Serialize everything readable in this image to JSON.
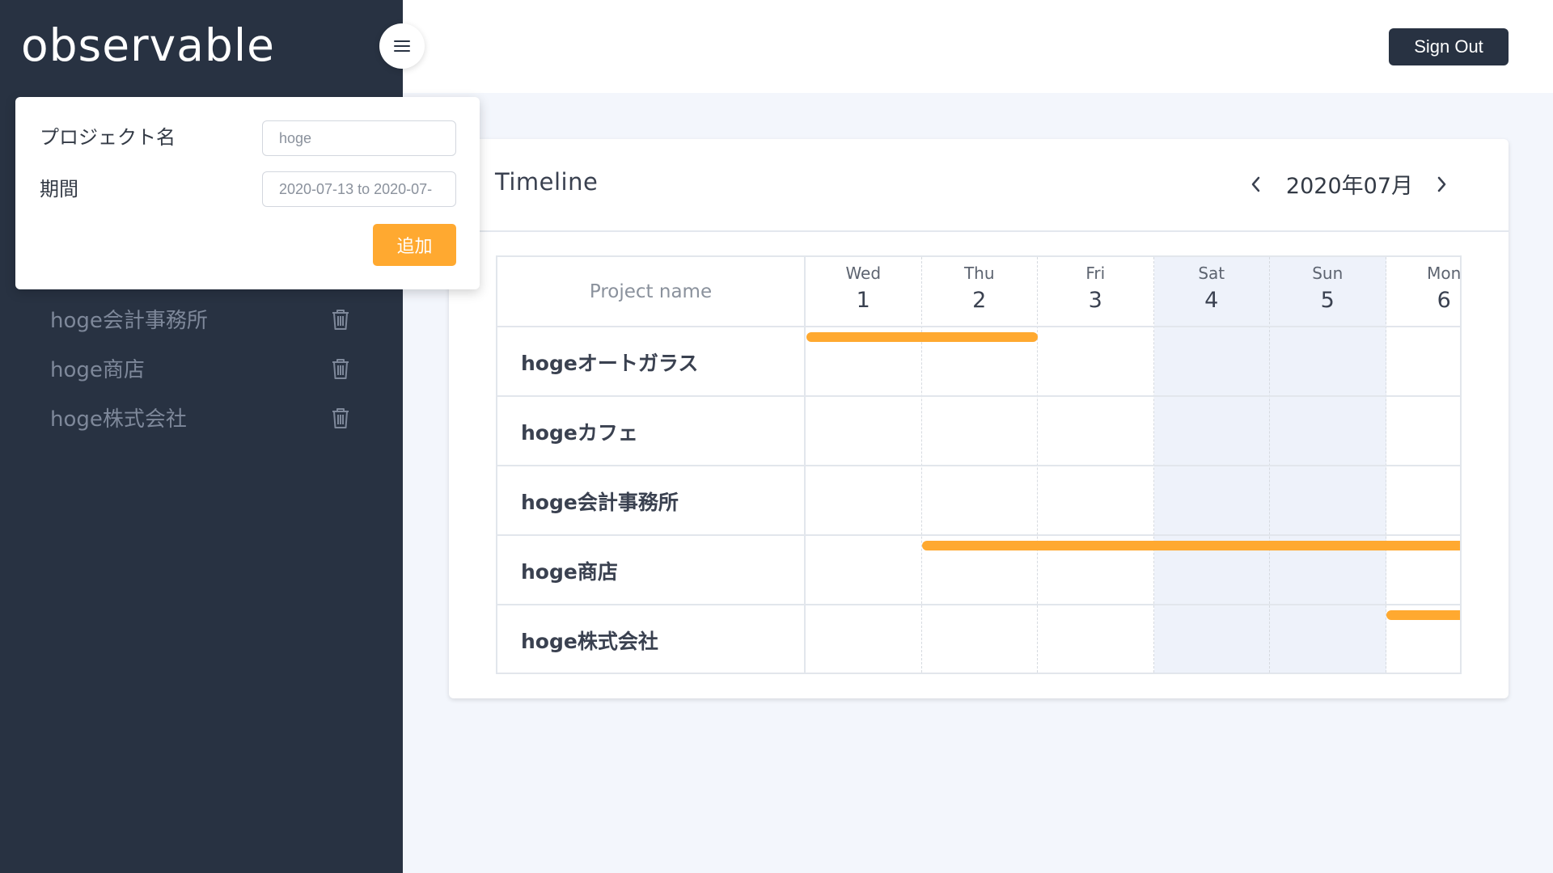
{
  "app": {
    "logo": "observable"
  },
  "header": {
    "signout_label": "Sign Out"
  },
  "form": {
    "name_label": "プロジェクト名",
    "name_value": "hoge",
    "period_label": "期間",
    "period_value": "2020-07-13 to 2020-07-",
    "add_label": "追加"
  },
  "sidebar": {
    "projects": [
      {
        "label": "hoge会計事務所"
      },
      {
        "label": "hoge商店"
      },
      {
        "label": "hoge株式会社"
      }
    ]
  },
  "timeline": {
    "title": "Timeline",
    "month": "2020年07月",
    "project_header": "Project name",
    "days": [
      {
        "name": "Wed",
        "num": "1",
        "weekend": false
      },
      {
        "name": "Thu",
        "num": "2",
        "weekend": false
      },
      {
        "name": "Fri",
        "num": "3",
        "weekend": false
      },
      {
        "name": "Sat",
        "num": "4",
        "weekend": true
      },
      {
        "name": "Sun",
        "num": "5",
        "weekend": true
      },
      {
        "name": "Mon",
        "num": "6",
        "weekend": false
      }
    ],
    "rows": [
      {
        "name": "hogeオートガラス"
      },
      {
        "name": "hogeカフェ"
      },
      {
        "name": "hoge会計事務所"
      },
      {
        "name": "hoge商店"
      },
      {
        "name": "hoge株式会社"
      }
    ],
    "accent_color": "#ffa930"
  }
}
